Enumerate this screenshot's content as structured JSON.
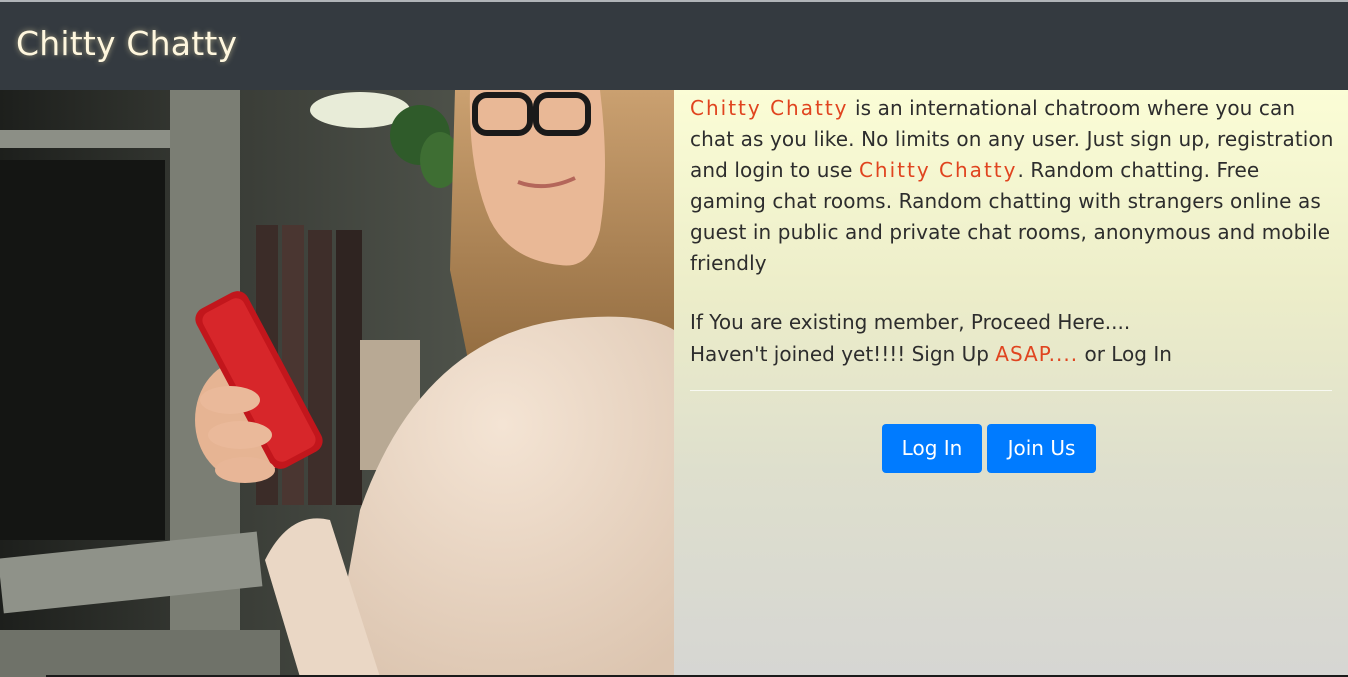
{
  "brand": {
    "name": "Chitty Chatty"
  },
  "hero_image": {
    "alt": "woman-with-phone"
  },
  "intro": {
    "brand_accent_1": "Chitty Chatty",
    "text_1": " is an international chatroom where you can chat as you like. No limits on any user. Just sign up, registration and login to use ",
    "brand_accent_2": "Chitty Chatty",
    "text_2": ". Random chatting. Free gaming chat rooms. Random chatting with strangers online as guest in public and private chat rooms, anonymous and mobile friendly"
  },
  "member": {
    "line1": "If You are existing member, Proceed Here....",
    "line2_before": "Haven't joined yet!!!! Sign Up ",
    "line2_accent": "ASAP....",
    "line2_after": " or Log In"
  },
  "buttons": {
    "login_label": "Log In",
    "join_label": "Join Us"
  },
  "colors": {
    "navbar": "#343a40",
    "accent": "#e0441f",
    "button": "#007bff"
  }
}
